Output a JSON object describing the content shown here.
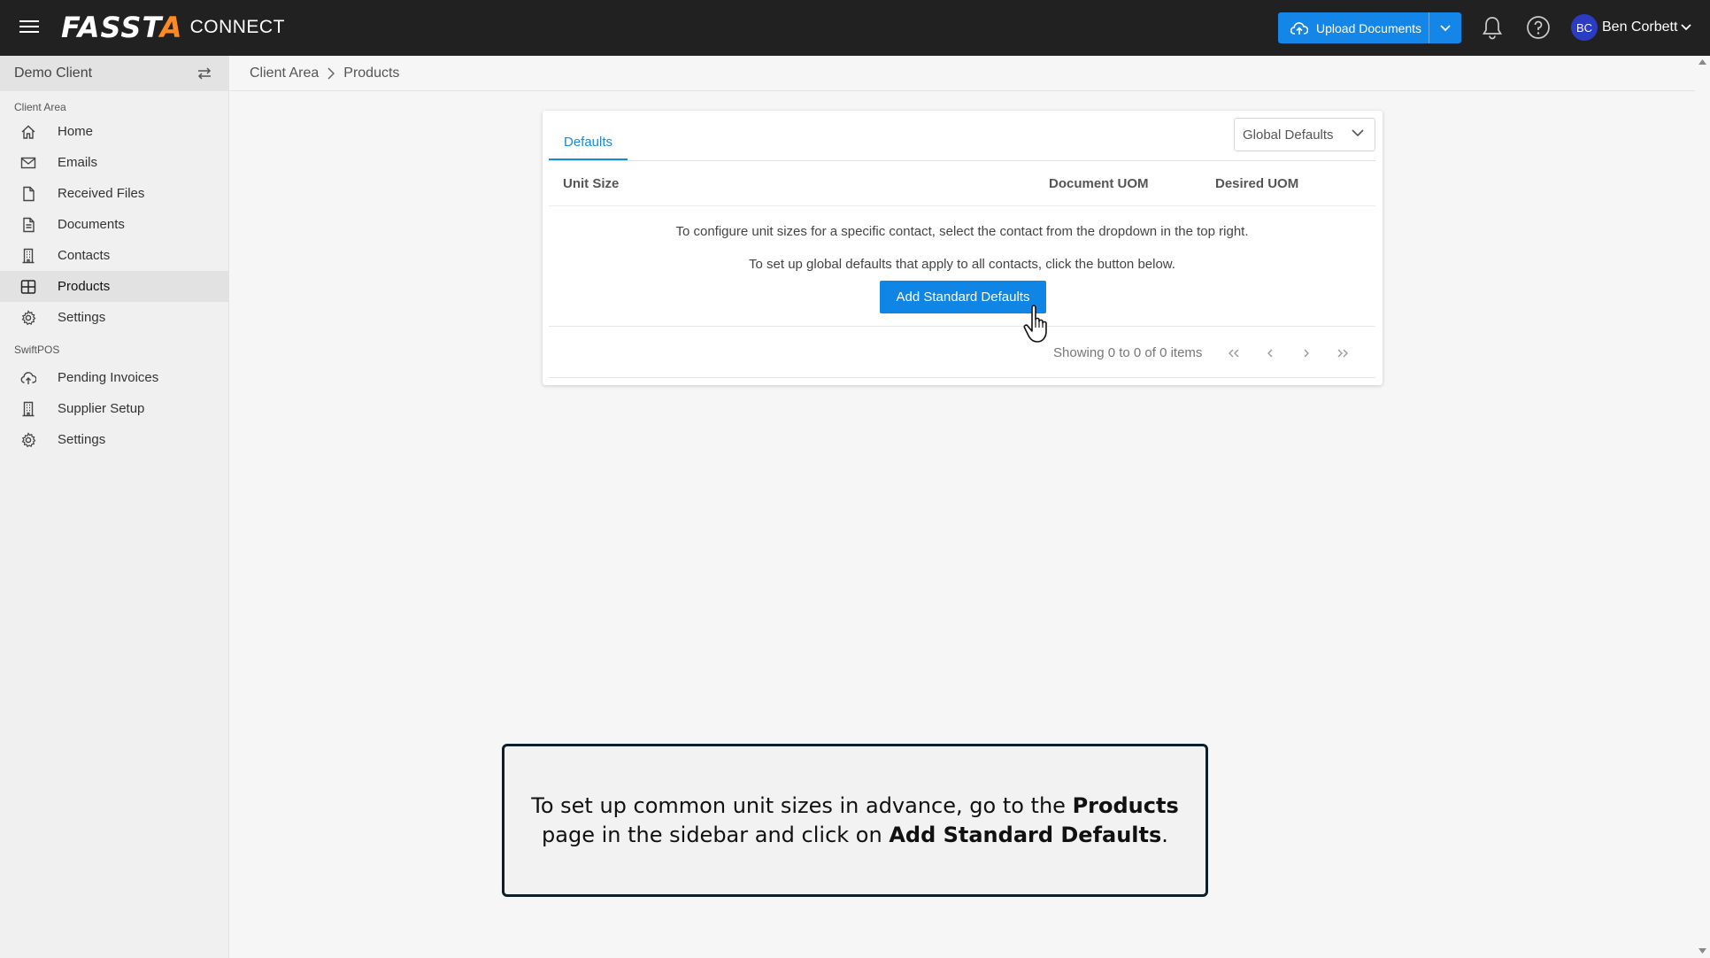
{
  "app": {
    "logo_main": "FASST",
    "logo_x": "A",
    "logo_sub": "CONNECT",
    "upload_label": "Upload Documents",
    "user_initials": "BC",
    "user_name": "Ben Corbett",
    "colors": {
      "topbar": "#212121",
      "accent": "#1486e8",
      "logo_accent": "#ff8a1f",
      "avatar": "#2b3cc2"
    }
  },
  "sidebar": {
    "client": "Demo Client",
    "section1": "Client Area",
    "items1": [
      "Home",
      "Emails",
      "Received Files",
      "Documents",
      "Contacts",
      "Products",
      "Settings"
    ],
    "icons1": [
      "home-icon",
      "mail-icon",
      "file-icon",
      "document-icon",
      "building-icon",
      "grid-icon",
      "gear-icon"
    ],
    "active": "Products",
    "section2": "SwiftPOS",
    "items2": [
      "Pending Invoices",
      "Supplier Setup",
      "Settings"
    ],
    "icons2": [
      "cloud-upload-icon",
      "building-icon",
      "gear-icon"
    ]
  },
  "breadcrumb": {
    "root": "Client Area",
    "current": "Products"
  },
  "main": {
    "tab": "Defaults",
    "dropdown_value": "Global Defaults",
    "columns": [
      "Unit Size",
      "Document UOM",
      "Desired UOM"
    ],
    "message1": "To configure unit sizes for a specific contact, select the contact from the dropdown in the top right.",
    "message2": "To set up global defaults that apply to all contacts, click the button below.",
    "button": "Add Standard Defaults",
    "pagination_info": "Showing 0 to 0 of 0 items"
  },
  "caption": {
    "part1": "To set up common unit sizes in advance, go to the ",
    "bold1": "Products",
    "part2": " page in the sidebar and click on ",
    "bold2": "Add Standard Defaults",
    "part3": "."
  }
}
